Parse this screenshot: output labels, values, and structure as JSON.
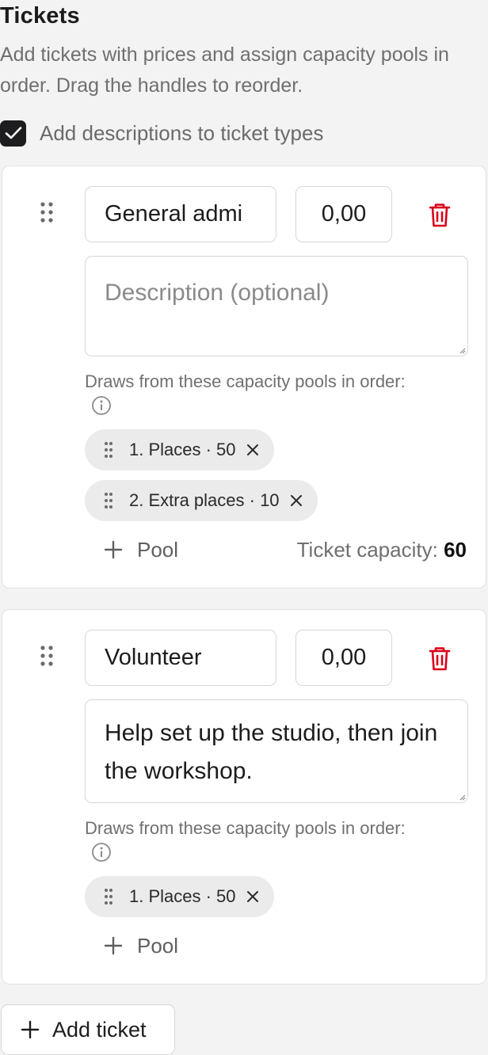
{
  "header": {
    "title": "Tickets",
    "subtitle": "Add tickets with prices and assign capacity pools in order. Drag the handles to reorder.",
    "descriptions_toggle": {
      "label": "Add descriptions to ticket types",
      "checked": true
    }
  },
  "tickets": [
    {
      "name": "General admi",
      "price": "0,00",
      "description_placeholder": "Description (optional)",
      "description": "",
      "pools_label": "Draws from these capacity pools in order:",
      "pools": [
        {
          "label": "1. Places · 50"
        },
        {
          "label": "2. Extra places · 10"
        }
      ],
      "add_pool_label": "Pool",
      "capacity_label": "Ticket capacity:",
      "capacity_value": "60"
    },
    {
      "name": "Volunteer",
      "price": "0,00",
      "description_placeholder": "Description (optional)",
      "description": "Help set up the studio, then join the workshop.",
      "pools_label": "Draws from these capacity pools in order:",
      "pools": [
        {
          "label": "1. Places · 50"
        }
      ],
      "add_pool_label": "Pool"
    }
  ],
  "footer": {
    "add_ticket_label": "Add ticket"
  },
  "colors": {
    "delete": "#d9001b",
    "checkbox": "#1d1d1f",
    "muted_text": "#6f6f6f"
  },
  "icons": [
    "check-icon",
    "drag-handle-icon",
    "trash-icon",
    "info-icon",
    "close-icon",
    "plus-icon",
    "resize-grip-icon"
  ]
}
